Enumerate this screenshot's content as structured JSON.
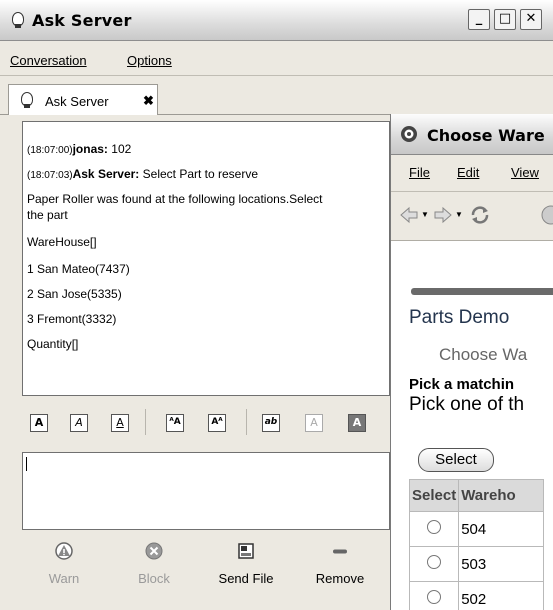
{
  "window": {
    "title": "Ask Server"
  },
  "menubar": {
    "items": [
      "Conversation",
      "Options"
    ]
  },
  "tab": {
    "label": "Ask Server",
    "close": "✖"
  },
  "chat": {
    "messages": [
      {
        "time": "(18:07:00)",
        "sender": "jonas:",
        "text": " 102"
      },
      {
        "time": "(18:07:03)",
        "sender": "Ask Server:",
        "text": " Select Part to reserve"
      },
      {
        "text": "Paper Roller was found at the following locations.Select"
      },
      {
        "text": "the part"
      },
      {
        "text": "WareHouse[]"
      },
      {
        "text": " 1 San Mateo(7437)"
      },
      {
        "text": " 2 San Jose(5335)"
      },
      {
        "text": " 3 Fremont(3332)"
      },
      {
        "text": "Quantity[]"
      }
    ]
  },
  "format_toolbar": {
    "buttons": [
      "bold-a",
      "italic-a",
      "underline-a",
      "smaller-font",
      "larger-font",
      "font-face",
      "foreground-color",
      "background-color"
    ],
    "glyphs": [
      "A",
      "A",
      "A",
      "ᴬA",
      "Aᴬ",
      "ab",
      "A",
      "A"
    ]
  },
  "actions": {
    "warn": "Warn",
    "block": "Block",
    "send_file": "Send File",
    "remove": "Remove"
  },
  "browser": {
    "title": "Choose Ware",
    "menu": [
      "File",
      "Edit",
      "View"
    ],
    "heading": "Parts Demo",
    "subheading": "Choose Wa",
    "pick_bold": "Pick a matchin",
    "pick_normal": "Pick one of th",
    "select_button": "Select",
    "table": {
      "headers": [
        "Select",
        "Wareho"
      ],
      "rows": [
        "504",
        "503",
        "502"
      ]
    }
  },
  "colors": {
    "heading": "#24354e",
    "table_header_bg": "#dadada"
  }
}
